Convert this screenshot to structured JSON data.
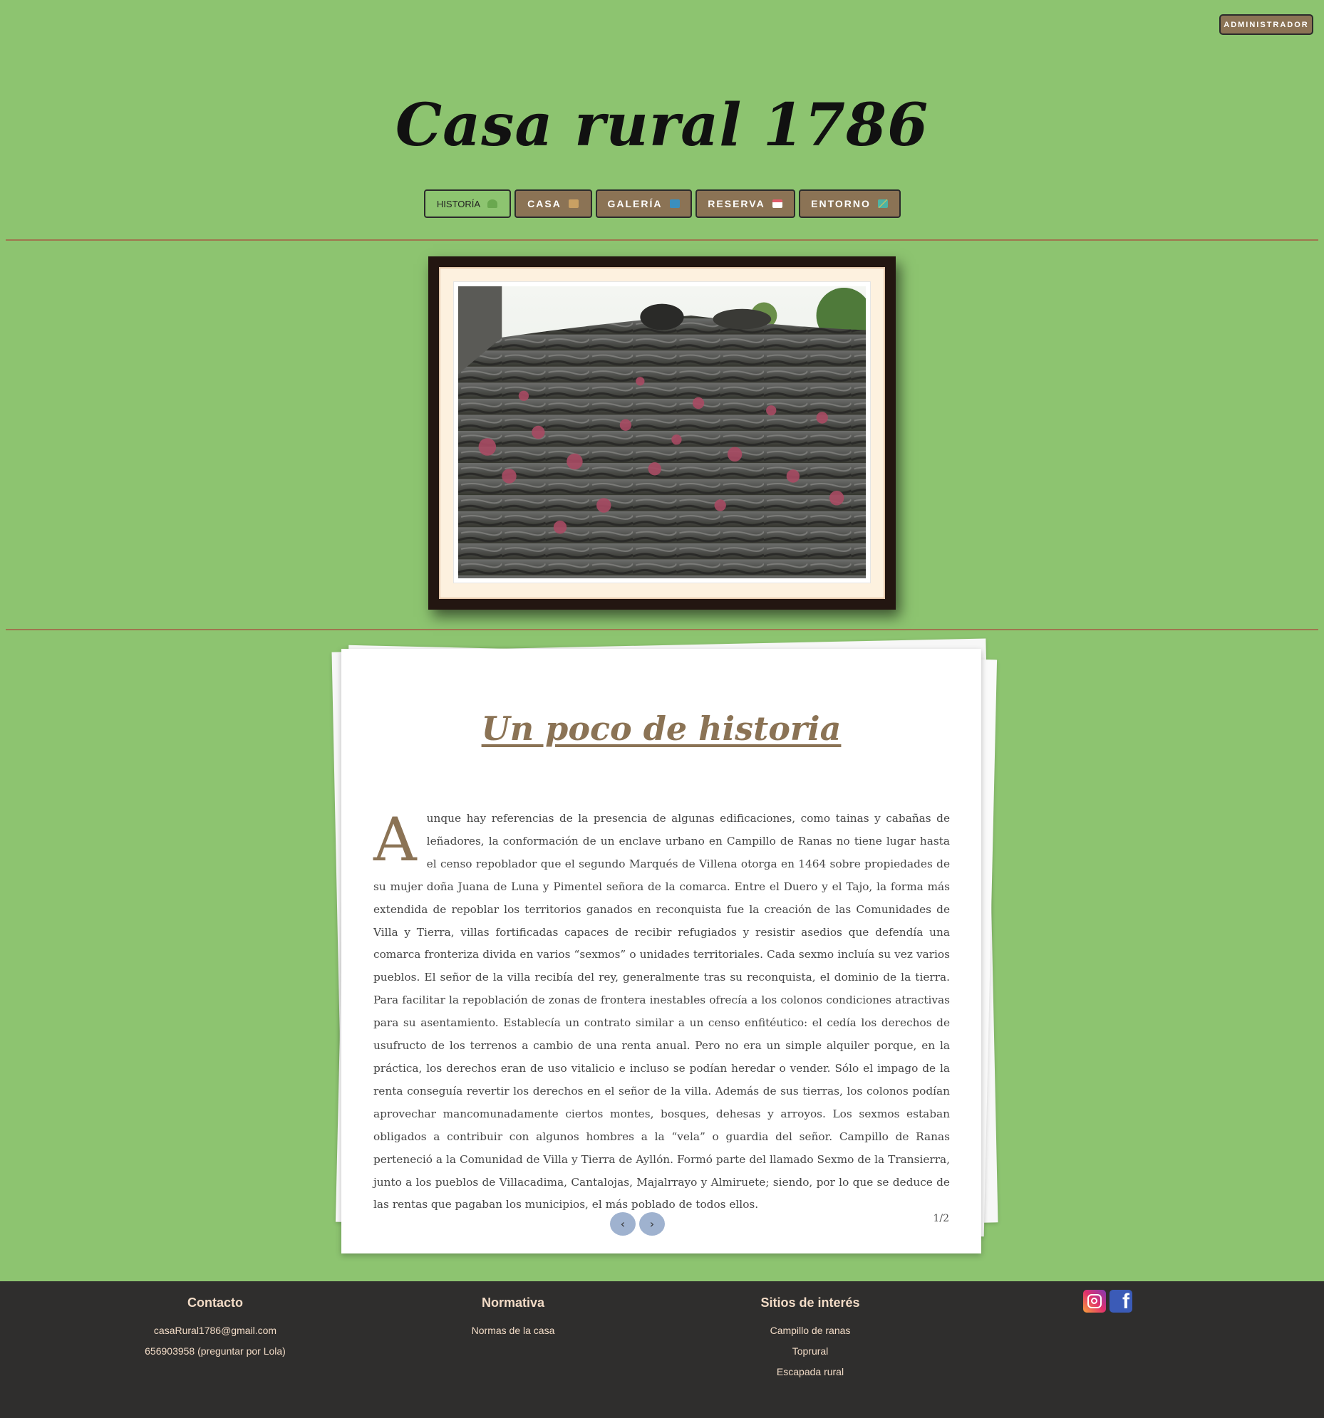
{
  "header": {
    "admin_label": "ADMINISTRADOR",
    "site_title": "Casa rural 1786"
  },
  "nav": {
    "items": [
      {
        "label": "HISTORÍA",
        "icon": "tree-icon",
        "color": "#6aa84f",
        "active": true
      },
      {
        "label": "CASA",
        "icon": "house-icon",
        "color": "#c9a063",
        "active": false
      },
      {
        "label": "GALERÍA",
        "icon": "picture-icon",
        "color": "#3a8fbf",
        "active": false
      },
      {
        "label": "RESERVA",
        "icon": "calendar-icon",
        "color": "#e05c6b",
        "active": false
      },
      {
        "label": "ENTORNO",
        "icon": "map-icon",
        "color": "#4db3a5",
        "active": false
      }
    ]
  },
  "photo": {
    "subject": "slate roof with red flowers"
  },
  "article": {
    "title": "Un poco de historia",
    "drop_cap": "A",
    "body": "unque hay referencias de la presencia de algunas edificaciones, como tainas y cabañas de leñadores, la conformación de un enclave urbano en Campillo de Ranas no tiene lugar hasta el censo repoblador que el segundo Marqués de Villena otorga en 1464 sobre propiedades de su mujer doña Juana de Luna y Pimentel señora de la comarca. Entre el Duero y el Tajo, la forma más extendida de repoblar los territorios ganados en reconquista fue la creación de las Comunidades de Villa y Tierra, villas fortificadas capaces de recibir refugiados y resistir asedios que defendía una comarca fronteriza divida en varios “sexmos” o unidades territoriales. Cada sexmo incluía su vez varios pueblos. El señor de la villa recibía del rey, generalmente tras su reconquista, el dominio de la tierra. Para facilitar la repoblación de zonas de frontera inestables ofrecía a los colonos condiciones atractivas para su asentamiento. Establecía un contrato similar a un censo enfitéutico: el cedía los derechos de usufructo de los terrenos a cambio de una renta anual. Pero no era un simple alquiler porque, en la práctica, los derechos eran de uso vitalicio e incluso se podían heredar o vender. Sólo el impago de la renta conseguía revertir los derechos en el señor de la villa. Además de sus tierras, los colonos podían aprovechar mancomunadamente ciertos montes, bosques, dehesas y arroyos. Los sexmos estaban obligados a contribuir con algunos hombres a la “vela” o guardia del señor. Campillo de Ranas perteneció a la Comunidad de Villa y Tierra de Ayllón. Formó parte del llamado Sexmo de la Transierra, junto a los pueblos de Villacadima, Cantalojas, Majalrrayo y Almiruete; siendo, por lo que se deduce de las rentas que pagaban los municipios, el más poblado de todos ellos.",
    "prev_label": "‹",
    "next_label": "›",
    "page_indicator": "1/2"
  },
  "footer": {
    "contact": {
      "heading": "Contacto",
      "email": "casaRural1786@gmail.com",
      "phone": "656903958 (preguntar por Lola)"
    },
    "rules": {
      "heading": "Normativa",
      "link": "Normas de la casa"
    },
    "sites": {
      "heading": "Sitios de interés",
      "links": [
        "Campillo de ranas",
        "Toprural",
        "Escapada rural"
      ]
    },
    "social": [
      "instagram-icon",
      "facebook-icon"
    ]
  },
  "colors": {
    "background": "#8dc470",
    "accent": "#8b7355",
    "footer": "#2f2e2d",
    "footer_text": "#f2dbc6"
  }
}
